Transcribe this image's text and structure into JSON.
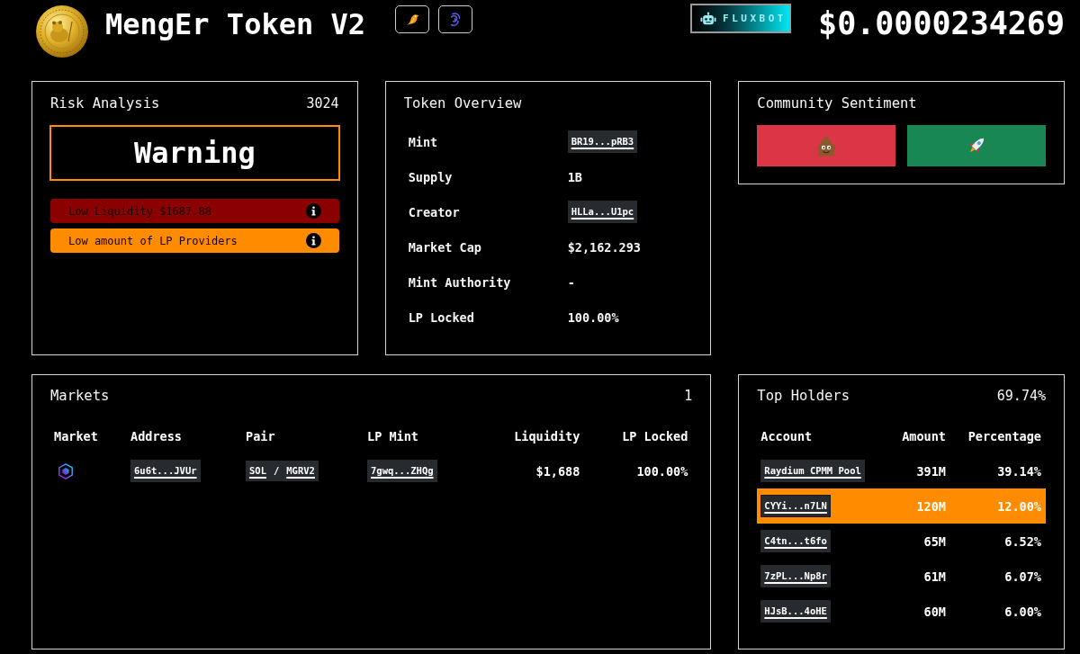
{
  "header": {
    "title": "MengEr Token V2",
    "badge": "FLUXBOT",
    "price": "$0.0000234269"
  },
  "risk_analysis": {
    "title": "Risk Analysis",
    "score": "3024",
    "verdict": "Warning",
    "flags": [
      {
        "text": "Low Liquidity $1687.88",
        "color": "#8b0000"
      },
      {
        "text": "Low amount of LP Providers",
        "color": "#ff8c00"
      }
    ]
  },
  "token_overview": {
    "title": "Token Overview",
    "rows": [
      {
        "label": "Mint",
        "value": "BR19...pRB3",
        "kind": "address"
      },
      {
        "label": "Supply",
        "value": "1B",
        "kind": "text"
      },
      {
        "label": "Creator",
        "value": "HLLa...U1pc",
        "kind": "address"
      },
      {
        "label": "Market Cap",
        "value": "$2,162.293",
        "kind": "text"
      },
      {
        "label": "Mint Authority",
        "value": "-",
        "kind": "text"
      },
      {
        "label": "LP Locked",
        "value": "100.00%",
        "kind": "text"
      }
    ]
  },
  "community_sentiment": {
    "title": "Community Sentiment",
    "votes": [
      {
        "kind": "bearish",
        "color": "#dc3545"
      },
      {
        "kind": "bullish",
        "color": "#198754"
      }
    ]
  },
  "markets": {
    "title": "Markets",
    "count": "1",
    "columns": [
      "Market",
      "Address",
      "Pair",
      "LP Mint",
      "Liquidity",
      "LP Locked"
    ],
    "rows": [
      {
        "address": "6u6t...JVUr",
        "pair": {
          "base": "SOL",
          "separator": "/",
          "quote": "MGRV2"
        },
        "lp_mint": "7gwq...ZHQg",
        "liquidity": "$1,688",
        "lp_locked": "100.00%"
      }
    ]
  },
  "top_holders": {
    "title": "Top Holders",
    "total": "69.74%",
    "columns": [
      "Account",
      "Amount",
      "Percentage"
    ],
    "rows": [
      {
        "account": "Raydium CPMM Pool",
        "amount": "391M",
        "percentage": "39.14%",
        "highlighted": false
      },
      {
        "account": "CYYi...n7LN",
        "amount": "120M",
        "percentage": "12.00%",
        "highlighted": true
      },
      {
        "account": "C4tn...t6fo",
        "amount": "65M",
        "percentage": "6.52%",
        "highlighted": false
      },
      {
        "account": "7zPL...Np8r",
        "amount": "61M",
        "percentage": "6.07%",
        "highlighted": false
      },
      {
        "account": "HJsB...4oHE",
        "amount": "60M",
        "percentage": "6.00%",
        "highlighted": false
      }
    ]
  }
}
